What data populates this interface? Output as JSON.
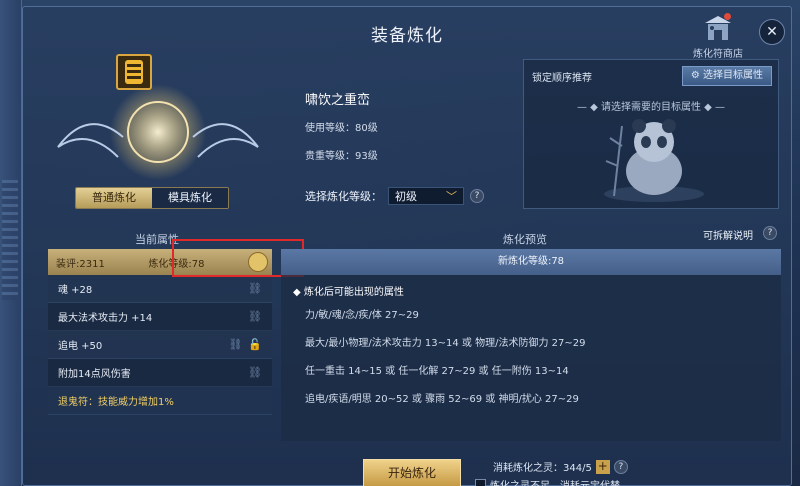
{
  "title": "装备炼化",
  "shop": {
    "label": "炼化符商店"
  },
  "close": "✕",
  "mode_tabs": [
    "普通炼化",
    "模具炼化"
  ],
  "item": {
    "name": "啸饮之重峦",
    "use_level": "使用等级：80级",
    "value_level": "贵重等级：93级"
  },
  "level_select": {
    "label": "选择炼化等级：",
    "value": "初级",
    "help": "?"
  },
  "target": {
    "lock_label": "锁定顺序推荐",
    "button": "选择目标属性",
    "hint": "请选择需要的目标属性"
  },
  "current": {
    "title": "当前属性",
    "score": "装评:2311",
    "level": "炼化等级:78",
    "attrs": [
      {
        "text": "魂 +28",
        "lock": false,
        "gold": false
      },
      {
        "text": "最大法术攻击力 +14",
        "lock": false,
        "gold": false
      },
      {
        "text": "追电 +50",
        "lock": true,
        "gold": false
      },
      {
        "text": "附加14点风伤害",
        "lock": false,
        "gold": false
      },
      {
        "text": "退鬼符：技能威力增加1%",
        "lock": false,
        "gold": true
      }
    ]
  },
  "preview": {
    "title": "炼化预览",
    "explain": "可拆解说明",
    "new_level": "新炼化等级:78",
    "may_title": "◆ 炼化后可能出现的属性",
    "lines": [
      "力/敏/魂/念/疾/体 27~29",
      "最大/最小物理/法术攻击力 13~14 或 物理/法术防御力 27~29",
      "任一重击 14~15 或 任一化解 27~29 或 任一附伤 13~14",
      "追电/疾语/明思 20~52 或 骤雨 52~69 或 神明/扰心 27~29"
    ]
  },
  "start_button": "开始炼化",
  "cost": "消耗炼化之灵：344/5",
  "substitute": "炼化之灵不足，消耗元宝代替"
}
